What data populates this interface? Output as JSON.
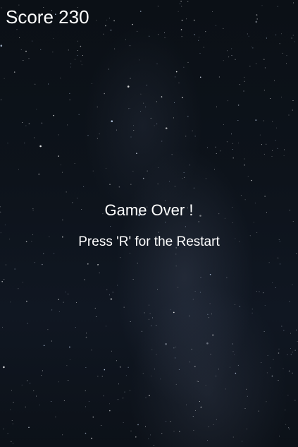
{
  "hud": {
    "score_text": "Score 230"
  },
  "game_over": {
    "title": "Game Over !",
    "restart_hint": "Press 'R' for the Restart"
  },
  "colors": {
    "text": "#ffffff",
    "sky": "#0d131b"
  }
}
